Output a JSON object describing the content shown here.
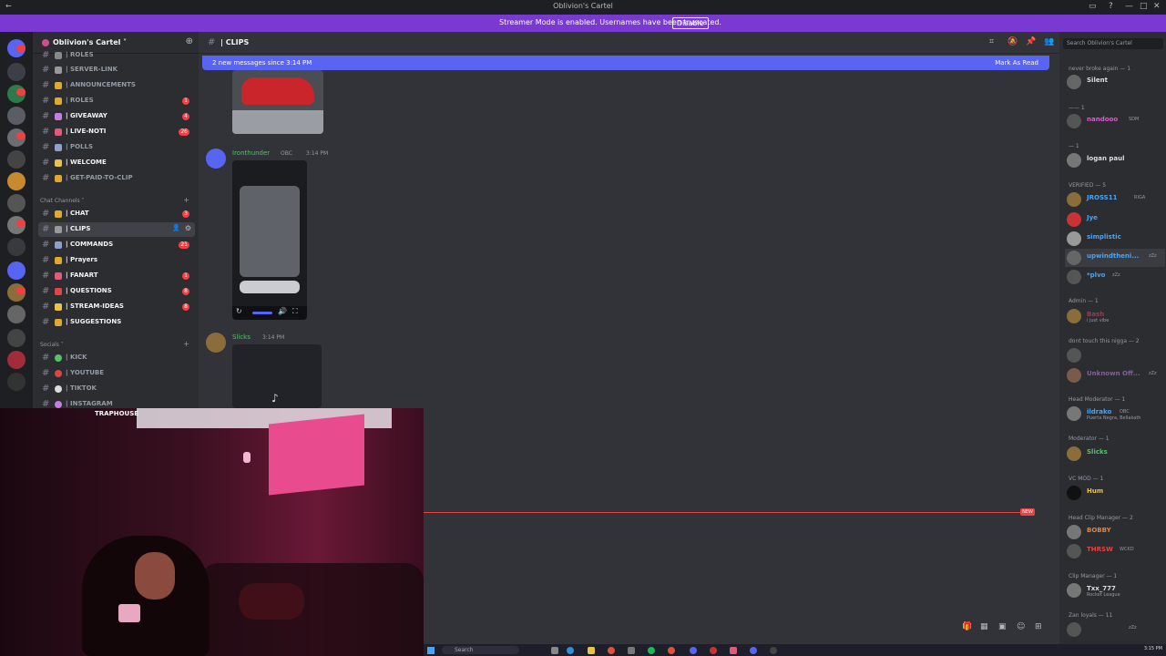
{
  "window": {
    "title": "Oblivion's Cartel",
    "controls": [
      "—",
      "□",
      "✕"
    ]
  },
  "banner": {
    "text": "Streamer Mode is enabled. Usernames have been truncated.",
    "button": "Disable"
  },
  "server": {
    "name": "Oblivion's Cartel ˅"
  },
  "channels": [
    {
      "label": "| ROLES",
      "emoji_color": "#888",
      "badge": ""
    },
    {
      "label": "| SERVER-LINK",
      "emoji_color": "#999",
      "badge": ""
    },
    {
      "label": "| ANNOUNCEMENTS",
      "emoji_color": "#e0a82e",
      "badge": ""
    },
    {
      "label": "| ROLES",
      "emoji_color": "#e0a82e",
      "badge": "1"
    },
    {
      "label": "| GIVEAWAY",
      "emoji_color": "#c57de0",
      "badge": "4"
    },
    {
      "label": "| LIVE-NOTI",
      "emoji_color": "#e05a7a",
      "badge": "26"
    },
    {
      "label": "| POLLS",
      "emoji_color": "#8da0c9",
      "badge": ""
    },
    {
      "label": "| WELCOME",
      "emoji_color": "#e8c24b",
      "badge": ""
    },
    {
      "label": "| GET-PAID-TO-CLIP",
      "emoji_color": "#e0a82e",
      "badge": ""
    }
  ],
  "categories": {
    "chat": "Chat Channels ˅",
    "socials": "Socials ˅"
  },
  "chat_channels": [
    {
      "label": "| CHAT",
      "emoji_color": "#e0a82e",
      "badge": "3"
    },
    {
      "label": "| CLIPS",
      "emoji_color": "#999",
      "badge": ""
    },
    {
      "label": "| COMMANDS",
      "emoji_color": "#8da0c9",
      "badge": "21"
    },
    {
      "label": "| Prayers",
      "emoji_color": "#e0a82e",
      "badge": ""
    },
    {
      "label": "| FANART",
      "emoji_color": "#e05a7a",
      "badge": "1"
    },
    {
      "label": "| QUESTIONS",
      "emoji_color": "#e04545",
      "badge": "8"
    },
    {
      "label": "| STREAM-IDEAS",
      "emoji_color": "#e8c24b",
      "badge": "8"
    },
    {
      "label": "| SUGGESTIONS",
      "emoji_color": "#e0a82e",
      "badge": ""
    }
  ],
  "social_channels": [
    {
      "label": "| KICK",
      "emoji_color": "#53c26b"
    },
    {
      "label": "| YOUTUBE",
      "emoji_color": "#e04545"
    },
    {
      "label": "| TIKTOK",
      "emoji_color": "#ddd"
    },
    {
      "label": "| INSTAGRAM",
      "emoji_color": "#c57de0"
    }
  ],
  "chat": {
    "channel_name": "| CLIPS",
    "new_messages": "2 new messages since 3:14 PM",
    "mark_read": "Mark As Read",
    "messages": [
      {
        "author": "Ironthunder",
        "tag": "OBC",
        "time": "3:14 PM",
        "color": "#53c26b"
      },
      {
        "author": "Slicks",
        "tag": "",
        "time": "3:14 PM",
        "color": "#53c26b"
      }
    ],
    "new_marker": "NEW"
  },
  "members": {
    "search_placeholder": "Search Oblivion's Cartel",
    "groups": [
      {
        "role": "never broke again — 1",
        "name": "Silent",
        "color": "#dbdee1"
      },
      {
        "role": "—— 1",
        "name": "nandooo",
        "color": "#e05ad0",
        "tag": "SDM"
      },
      {
        "role": "— 1",
        "name": "logan paul",
        "color": "#dbdee1"
      },
      {
        "role": "VERIFIED — 5",
        "name": "JROSS11",
        "color": "#4ea2f0",
        "tag": "RIGA"
      },
      {
        "role": "",
        "name": "Jye",
        "color": "#4ea2f0"
      },
      {
        "role": "",
        "name": "simplistic",
        "color": "#4ea2f0"
      },
      {
        "role": "",
        "name": "upwindtheni...",
        "color": "#4ea2f0",
        "tag": "zZz"
      },
      {
        "role": "",
        "name": "*plvo",
        "color": "#4ea2f0",
        "tag": "zZz"
      },
      {
        "role": "Admin — 1",
        "name": "Bash",
        "color": "#e05a7a",
        "sub": "i just vibe"
      },
      {
        "role": "dont touch this nigga — 2",
        "name": "",
        "color": "#e05a7a"
      },
      {
        "role": "",
        "name": "Unknown Off...",
        "color": "#c57de0",
        "tag": "zZz"
      },
      {
        "role": "Head Moderator — 1",
        "name": "ildrako",
        "color": "#4ea2f0",
        "tag": "OBC",
        "sub": "Puerta Negra, Bellakath"
      },
      {
        "role": "Moderator — 1",
        "name": "Slicks",
        "color": "#53c26b"
      },
      {
        "role": "VC MOD — 1",
        "name": "Hum",
        "color": "#e8c24b"
      },
      {
        "role": "Head Clip Manager — 2",
        "name": "BOBBY",
        "color": "#e8823c"
      },
      {
        "role": "",
        "name": "THRSW",
        "color": "#e04545",
        "tag": "WCKD"
      },
      {
        "role": "Clip Manager — 1",
        "name": "Txx_777",
        "color": "#dbdee1",
        "sub": "Rocket League"
      },
      {
        "role": "Zan loyals — 11",
        "name": "",
        "color": "#dbdee1",
        "tag": "zZz"
      }
    ]
  },
  "webcam": {
    "sign": "TRAPHOUSE"
  },
  "taskbar": {
    "search": "Search",
    "time": "3:15 PM"
  }
}
